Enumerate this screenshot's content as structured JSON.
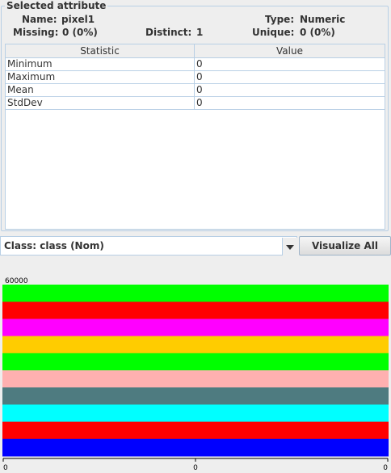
{
  "panel": {
    "title": "Selected attribute",
    "name_label": "Name:",
    "name_value": "pixel1",
    "type_label": "Type:",
    "type_value": "Numeric",
    "missing_label": "Missing:",
    "missing_value": "0 (0%)",
    "distinct_label": "Distinct:",
    "distinct_value": "1",
    "unique_label": "Unique:",
    "unique_value": "0 (0%)"
  },
  "table": {
    "headers": [
      "Statistic",
      "Value"
    ],
    "rows": [
      [
        "Minimum",
        "0"
      ],
      [
        "Maximum",
        "0"
      ],
      [
        "Mean",
        "0"
      ],
      [
        "StdDev",
        "0"
      ]
    ]
  },
  "classbar": {
    "class_value": "Class: class (Nom)",
    "visualize_label": "Visualize All"
  },
  "chart_data": {
    "type": "bar",
    "stacked": true,
    "ymax_label": "60000",
    "x_ticks": [
      "0",
      "0",
      "0"
    ],
    "series": [
      {
        "color": "#ff0000"
      },
      {
        "color": "#0000ff"
      },
      {
        "color": "#00ffff"
      },
      {
        "color": "#4e7b80"
      },
      {
        "color": "#ffb0b0"
      },
      {
        "color": "#ffcc00"
      },
      {
        "color": "#ff00ff"
      },
      {
        "color": "#00ff00"
      }
    ],
    "colors": {
      "red": "#ff0000",
      "blue": "#0000ff",
      "cyan": "#00ffff",
      "teal": "#4e7b80",
      "pink": "#ffb0b0",
      "orange": "#ffcc00",
      "magenta": "#ff00ff",
      "green": "#00ff00"
    }
  }
}
